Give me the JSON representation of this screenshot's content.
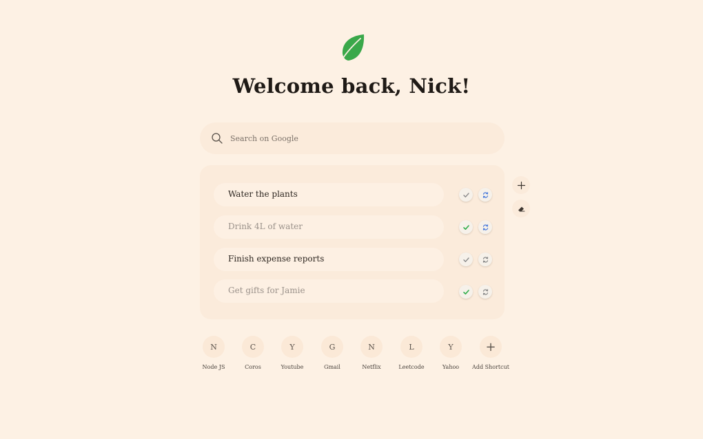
{
  "greeting": "Welcome back, Nick!",
  "search": {
    "placeholder": "Search on Google",
    "icon": "search-icon"
  },
  "todos": [
    {
      "text": "Water the plants",
      "done": false
    },
    {
      "text": "Drink 4L of water",
      "done": true
    },
    {
      "text": "Finish expense reports",
      "done": false
    },
    {
      "text": "Get gifts for Jamie",
      "done": true
    }
  ],
  "side_actions": [
    {
      "icon": "plus-icon"
    },
    {
      "icon": "eraser-icon"
    }
  ],
  "shortcuts": [
    {
      "letter": "N",
      "label": "Node JS"
    },
    {
      "letter": "C",
      "label": "Coros"
    },
    {
      "letter": "Y",
      "label": "Youtube"
    },
    {
      "letter": "G",
      "label": "Gmail"
    },
    {
      "letter": "N",
      "label": "Netflix"
    },
    {
      "letter": "L",
      "label": "Leetcode"
    },
    {
      "letter": "Y",
      "label": "Yahoo"
    },
    {
      "letter": "+",
      "label": "Add Shortcut"
    }
  ],
  "colors": {
    "background": "#fdf1e4",
    "leaf": "#3aa84a",
    "check_done": "#2fae4a",
    "check_pending": "#8a8a8a",
    "repeat_active": "#4a7bdc",
    "repeat_inactive": "#8a8a8a"
  }
}
